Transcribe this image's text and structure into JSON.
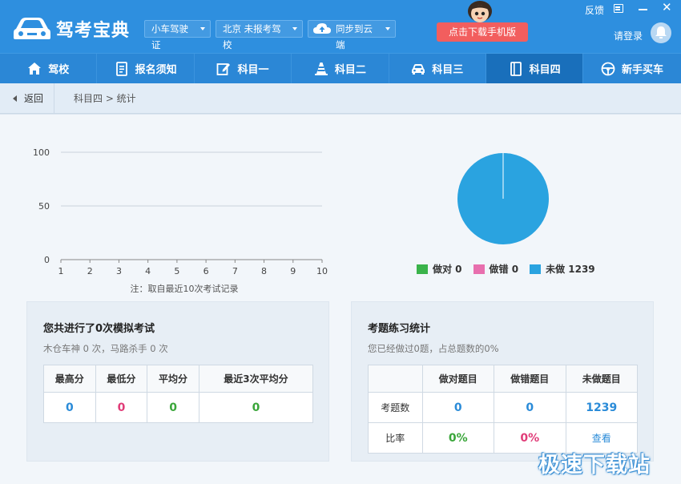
{
  "app": {
    "title": "驾考宝典",
    "license_type": "小车驾驶证",
    "location": "北京 未报考驾校",
    "sync": "同步到云端",
    "download_button": "点击下载手机版",
    "feedback": "反馈",
    "login": "请登录"
  },
  "nav": {
    "items": [
      {
        "label": "驾校",
        "icon": "home-icon"
      },
      {
        "label": "报名须知",
        "icon": "document-icon"
      },
      {
        "label": "科目一",
        "icon": "edit-icon"
      },
      {
        "label": "科目二",
        "icon": "cone-icon"
      },
      {
        "label": "科目三",
        "icon": "car-icon"
      },
      {
        "label": "科目四",
        "icon": "book-icon"
      },
      {
        "label": "新手买车",
        "icon": "steering-wheel-icon"
      }
    ],
    "active_index": 5
  },
  "breadcrumb": {
    "back": "返回",
    "path": "科目四 > 统计"
  },
  "chart_data": [
    {
      "type": "line",
      "x": [
        1,
        2,
        3,
        4,
        5,
        6,
        7,
        8,
        9,
        10
      ],
      "series": [],
      "ylim": [
        0,
        100
      ],
      "yticks": [
        0,
        50,
        100
      ],
      "xticks": [
        1,
        2,
        3,
        4,
        5,
        6,
        7,
        8,
        9,
        10
      ],
      "grid": true,
      "note": "注：取自最近10次考试记录"
    },
    {
      "type": "pie",
      "labels": [
        "做对",
        "做错",
        "未做"
      ],
      "values": [
        0,
        0,
        1239
      ],
      "colors": [
        "#3ab34a",
        "#e86fae",
        "#2aa3e0"
      ]
    }
  ],
  "legend": {
    "correct": "做对 0",
    "wrong": "做错 0",
    "undone": "未做 1239"
  },
  "exam_panel": {
    "title": "您共进行了0次模拟考试",
    "subtitle": "木仓车神 0 次，马路杀手 0 次",
    "headers": [
      "最高分",
      "最低分",
      "平均分",
      "最近3次平均分"
    ],
    "values": [
      "0",
      "0",
      "0",
      "0"
    ]
  },
  "practice_panel": {
    "title": "考题练习统计",
    "subtitle": "您已经做过0题，占总题数的0%",
    "headers": [
      "",
      "做对题目",
      "做错题目",
      "未做题目"
    ],
    "row1_label": "考题数",
    "row1": [
      "0",
      "0",
      "1239"
    ],
    "row2_label": "比率",
    "row2": [
      "0%",
      "0%",
      "查看"
    ]
  },
  "watermark": "极速下载站"
}
